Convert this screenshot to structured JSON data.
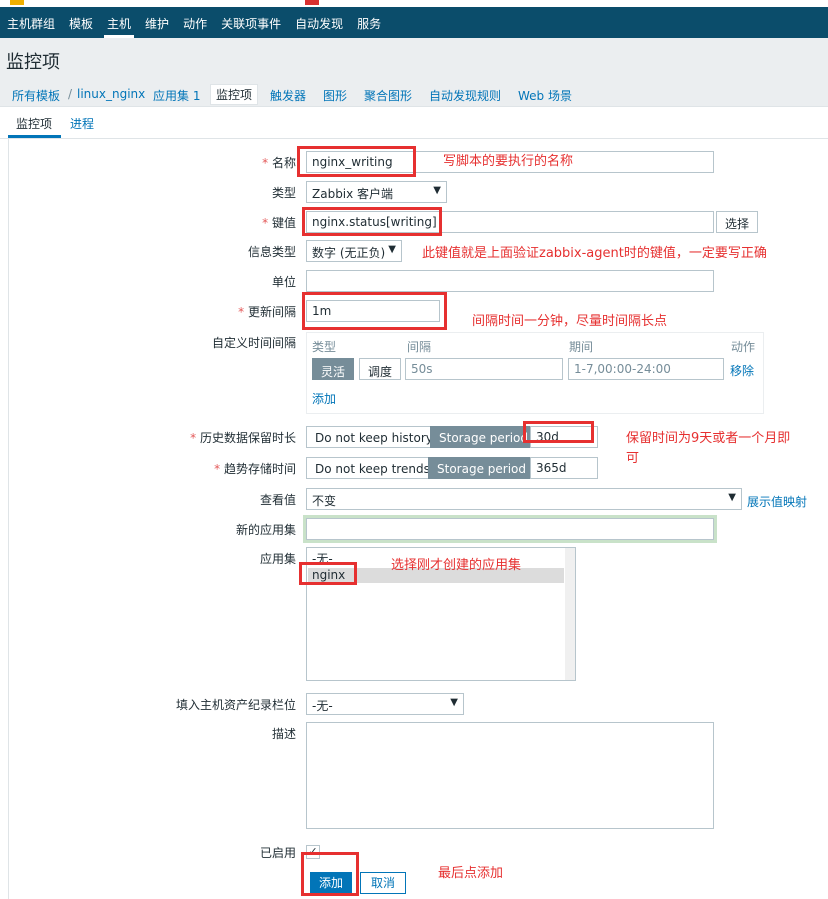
{
  "colors": {
    "nav_bg": "#0b4d6b",
    "accent": "#0275b8",
    "annotation": "#e63030",
    "segment_on": "#768d99"
  },
  "topnav": [
    "主机群组",
    "模板",
    "主机",
    "维护",
    "动作",
    "关联项事件",
    "自动发现",
    "服务"
  ],
  "page_title": "监控项",
  "breadcrumb": {
    "all_templates": "所有模板",
    "sep": "/",
    "template": "linux_nginx",
    "applications": "应用集 1",
    "items": "监控项",
    "triggers": "触发器",
    "graphs": "图形",
    "screens": "聚合图形",
    "discovery": "自动发现规则",
    "web": "Web 场景"
  },
  "tabs": {
    "item": "监控项",
    "process": "进程"
  },
  "form": {
    "name_label": "名称",
    "name_value": "nginx_writing",
    "type_label": "类型",
    "type_value": "Zabbix 客户端",
    "key_label": "键值",
    "key_value": "nginx.status[writing]",
    "select_button": "选择",
    "info_type_label": "信息类型",
    "info_type_value": "数字 (无正负)",
    "units_label": "单位",
    "units_value": "",
    "update_interval_label": "更新间隔",
    "update_interval_value": "1m",
    "custom_intervals_label": "自定义时间间隔",
    "ci_type_header": "类型",
    "ci_interval_header": "间隔",
    "ci_period_header": "期间",
    "ci_action_header": "动作",
    "ci_flexible": "灵活",
    "ci_scheduling": "调度",
    "ci_interval_placeholder": "50s",
    "ci_period_placeholder": "1-7,00:00-24:00",
    "ci_remove": "移除",
    "ci_add": "添加",
    "history_label": "历史数据保留时长",
    "history_off": "Do not keep history",
    "history_on": "Storage period",
    "history_value": "30d",
    "trends_label": "趋势存储时间",
    "trends_off": "Do not keep trends",
    "trends_on": "Storage period",
    "trends_value": "365d",
    "valuemap_label": "查看值",
    "valuemap_value": "不变",
    "valuemap_link": "展示值映射",
    "new_app_label": "新的应用集",
    "new_app_value": "",
    "apps_label": "应用集",
    "apps_options": [
      "-无-",
      "nginx"
    ],
    "inventory_label": "填入主机资产纪录栏位",
    "inventory_value": "-无-",
    "description_label": "描述",
    "enabled_label": "已启用",
    "enabled_check": "✓",
    "add_button": "添加",
    "cancel_button": "取消"
  },
  "annotations": {
    "name_note": "写脚本的要执行的名称",
    "key_note": "此键值就是上面验证zabbix-agent时的键值，一定要写正确",
    "interval_note": "间隔时间一分钟，尽量时间隔长点",
    "history_note_1": "保留时间为9天或者一个月即",
    "history_note_2": "可",
    "app_note": "选择刚才创建的应用集",
    "add_note": "最后点添加"
  }
}
